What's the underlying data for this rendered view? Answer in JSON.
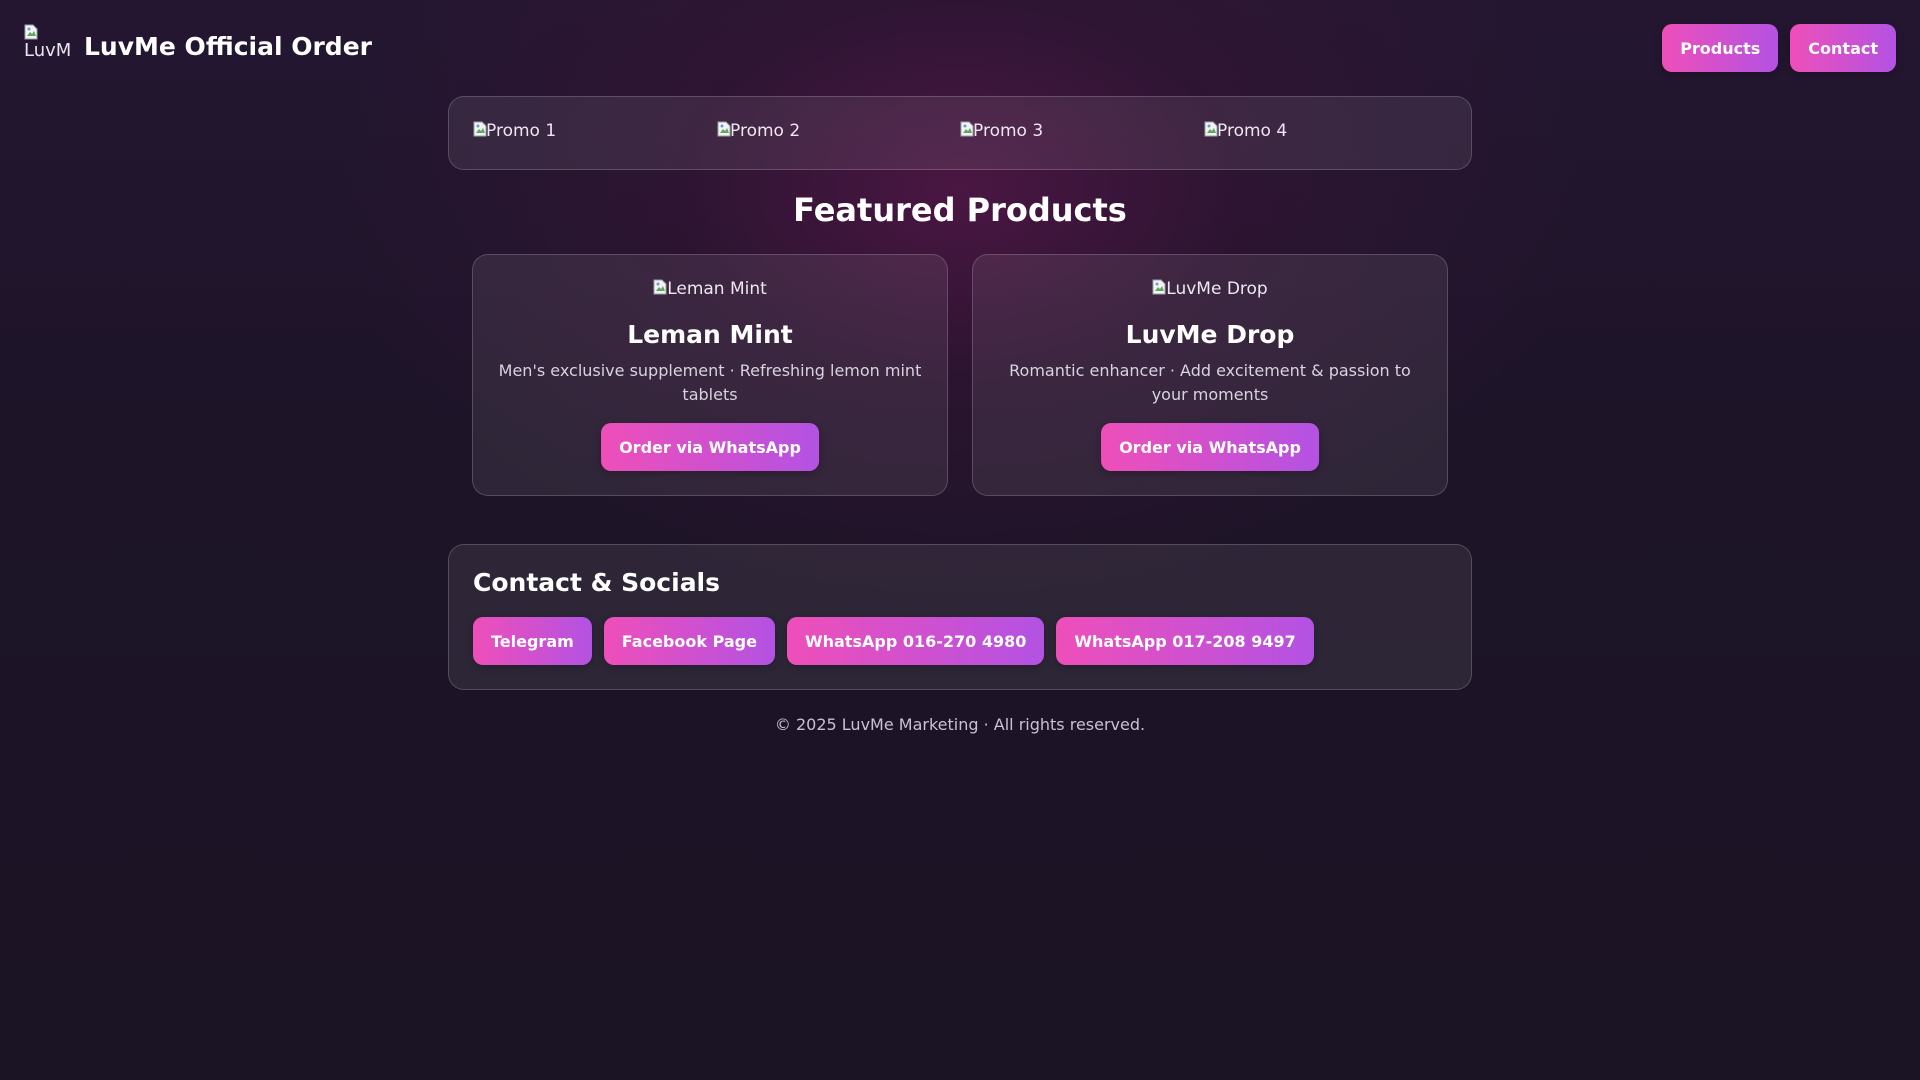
{
  "header": {
    "logo_alt": "LuvMe",
    "title": "LuvMe Official Order",
    "nav": [
      {
        "label": "Products"
      },
      {
        "label": "Contact"
      }
    ]
  },
  "promos": [
    {
      "alt": "Promo 1"
    },
    {
      "alt": "Promo 2"
    },
    {
      "alt": "Promo 3"
    },
    {
      "alt": "Promo 4"
    }
  ],
  "featured": {
    "title": "Featured Products",
    "products": [
      {
        "img_alt": "Leman Mint",
        "name": "Leman Mint",
        "description": "Men's exclusive supplement · Refreshing lemon mint tablets",
        "button": "Order via WhatsApp"
      },
      {
        "img_alt": "LuvMe Drop",
        "name": "LuvMe Drop",
        "description": "Romantic enhancer · Add excitement & passion to your moments",
        "button": "Order via WhatsApp"
      }
    ]
  },
  "contact": {
    "title": "Contact & Socials",
    "links": [
      {
        "label": "Telegram"
      },
      {
        "label": "Facebook Page"
      },
      {
        "label": "WhatsApp 016-270 4980"
      },
      {
        "label": "WhatsApp 017-208 9497"
      }
    ]
  },
  "footer": {
    "text": "© 2025 LuvMe Marketing · All rights reserved."
  },
  "colors": {
    "button_gradient_start": "#ee4fb9",
    "button_gradient_end": "#b352e3",
    "background": "#1d1428"
  },
  "icons": {
    "broken_image": "broken-image-icon"
  }
}
